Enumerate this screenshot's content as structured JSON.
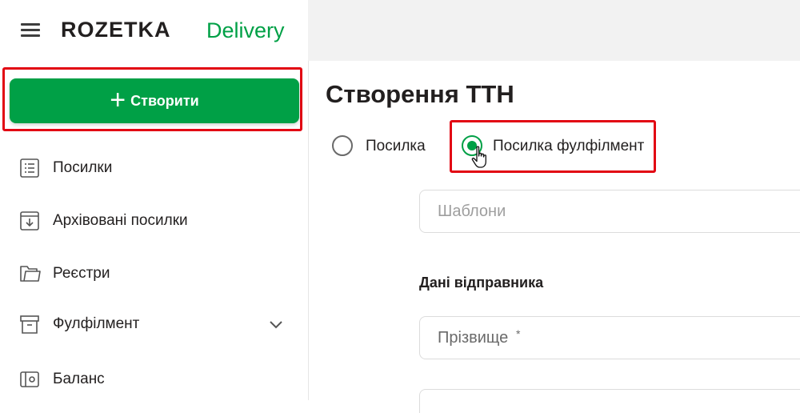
{
  "brand": {
    "logo": "ROZETKA",
    "product": "Delivery"
  },
  "sidebar": {
    "create_label": "Створити",
    "items": [
      {
        "label": "Посилки",
        "icon": "list-icon"
      },
      {
        "label": "Архівовані посилки",
        "icon": "archive-download-icon"
      },
      {
        "label": "Реєстри",
        "icon": "folder-icon"
      },
      {
        "label": "Фулфілмент",
        "icon": "box-icon",
        "expandable": true
      },
      {
        "label": "Баланс",
        "icon": "wallet-icon"
      }
    ]
  },
  "main": {
    "title": "Створення ТТН",
    "parcel_types": [
      {
        "label": "Посилка",
        "selected": false
      },
      {
        "label": "Посилка фулфілмент",
        "selected": true
      }
    ],
    "templates_placeholder": "Шаблони",
    "sender_section_title": "Дані відправника",
    "surname_placeholder": "Прізвище",
    "required_mark": "*"
  },
  "colors": {
    "accent": "#00a046",
    "highlight": "#e20613",
    "topbar": "#f2f2f2"
  }
}
